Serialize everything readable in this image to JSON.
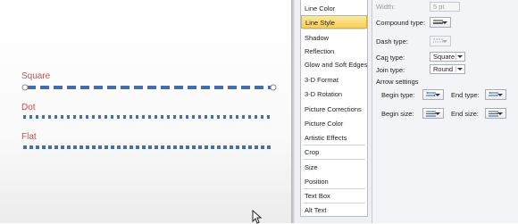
{
  "samples": {
    "square_label": "Square",
    "dot_label": "Dot",
    "flat_label": "Flat",
    "line_color": "#3f6eb5",
    "label_color": "#e24848"
  },
  "categories": [
    {
      "label": "Line Color",
      "selected": false
    },
    {
      "label": "Line Style",
      "selected": true
    },
    {
      "label": "Shadow",
      "selected": false
    },
    {
      "label": "Reflection",
      "selected": false
    },
    {
      "label": "Glow and Soft Edges",
      "selected": false
    },
    {
      "label": "3-D Format",
      "selected": false
    },
    {
      "label": "3-D Rotation",
      "selected": false
    },
    {
      "label": "Picture Corrections",
      "selected": false
    },
    {
      "label": "Picture Color",
      "selected": false
    },
    {
      "label": "Artistic Effects",
      "selected": false
    },
    {
      "label": "Crop",
      "selected": false
    },
    {
      "label": "Size",
      "selected": false
    },
    {
      "label": "Position",
      "selected": false
    },
    {
      "label": "Text Box",
      "selected": false
    },
    {
      "label": "Alt Text",
      "selected": false
    }
  ],
  "line_style": {
    "width_label": "Width:",
    "width_value": "5 pt",
    "compound_label": "Compound type:",
    "dash_label": "Dash type:",
    "cap_label": "Cap type:",
    "cap_value": "Square",
    "join_label": "Join type:",
    "join_value": "Round",
    "arrow_settings_label": "Arrow settings",
    "begin_type_label": "Begin type:",
    "end_type_label": "End type:",
    "begin_size_label": "Begin size:",
    "end_size_label": "End size:"
  }
}
